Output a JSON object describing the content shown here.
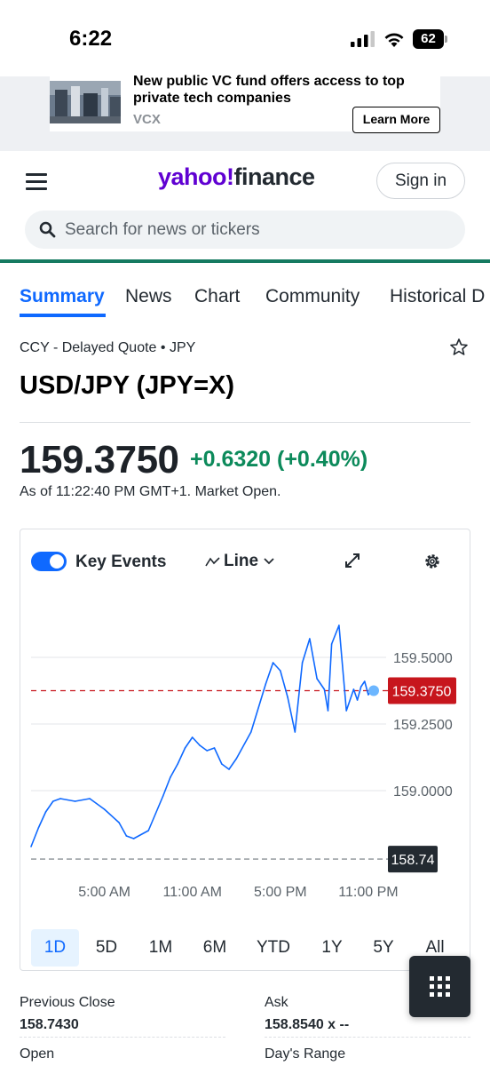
{
  "status_bar": {
    "time": "6:22",
    "battery": "62"
  },
  "ad": {
    "title": "New public VC fund offers access to top private tech companies",
    "sponsor": "VCX",
    "cta": "Learn More"
  },
  "header": {
    "logo_yahoo": "yahoo!",
    "logo_finance": "finance",
    "signin": "Sign in",
    "search_placeholder": "Search for news or tickers"
  },
  "tabs": [
    "Summary",
    "News",
    "Chart",
    "Community",
    "Historical D"
  ],
  "quote": {
    "source": "CCY - Delayed Quote • JPY",
    "title": "USD/JPY (JPY=X)",
    "price": "159.3750",
    "change": "+0.6320 (+0.40%)",
    "as_of": "As of 11:22:40 PM GMT+1. Market Open."
  },
  "chart_controls": {
    "key_events": "Key Events",
    "line": "Line",
    "ranges": [
      "1D",
      "5D",
      "1M",
      "6M",
      "YTD",
      "1Y",
      "5Y",
      "All"
    ],
    "active_range": "1D"
  },
  "chart_data": {
    "type": "line",
    "series": [
      {
        "x": [
          "00:00",
          "00:30",
          "01:00",
          "01:30",
          "02:00",
          "03:00",
          "04:00",
          "05:00",
          "06:00",
          "06:30",
          "07:00",
          "08:00",
          "09:00",
          "09:30",
          "10:00",
          "10:30",
          "11:00",
          "11:30",
          "12:00",
          "12:30",
          "13:00",
          "13:30",
          "14:00",
          "15:00",
          "16:00",
          "16:30",
          "17:00",
          "17:30",
          "18:00",
          "18:30",
          "19:00",
          "19:30",
          "20:00",
          "20:15",
          "20:30",
          "21:00",
          "21:30",
          "22:00",
          "22:15",
          "22:30",
          "22:45",
          "23:00",
          "23:15",
          "23:22"
        ],
        "values": [
          158.79,
          158.86,
          158.92,
          158.96,
          158.97,
          158.96,
          158.97,
          158.93,
          158.88,
          158.83,
          158.82,
          158.85,
          158.98,
          159.05,
          159.1,
          159.16,
          159.2,
          159.17,
          159.15,
          159.16,
          159.1,
          159.08,
          159.12,
          159.22,
          159.4,
          159.48,
          159.45,
          159.35,
          159.22,
          159.48,
          159.57,
          159.42,
          159.38,
          159.3,
          159.55,
          159.62,
          159.3,
          159.38,
          159.34,
          159.39,
          159.41,
          159.36,
          159.38,
          159.375
        ]
      }
    ],
    "x_ticks": [
      "5:00 AM",
      "11:00 AM",
      "5:00 PM",
      "11:00 PM"
    ],
    "y_ticks": [
      "159.5000",
      "159.2500",
      "159.0000"
    ],
    "last_price_label": "159.3750",
    "last_price": 159.375,
    "previous_close_label": "158.74",
    "previous_close": 158.743,
    "ylim": [
      158.72,
      159.72
    ],
    "colors": {
      "line": "#0f69ff",
      "last": "#c7161d",
      "prev": "#232a31"
    }
  },
  "stats": [
    {
      "label": "Previous Close",
      "value": "158.7430"
    },
    {
      "label": "Ask",
      "value": "158.8540 x --"
    },
    {
      "label": "Open",
      "value": ""
    },
    {
      "label": "Day's Range",
      "value": ""
    }
  ]
}
